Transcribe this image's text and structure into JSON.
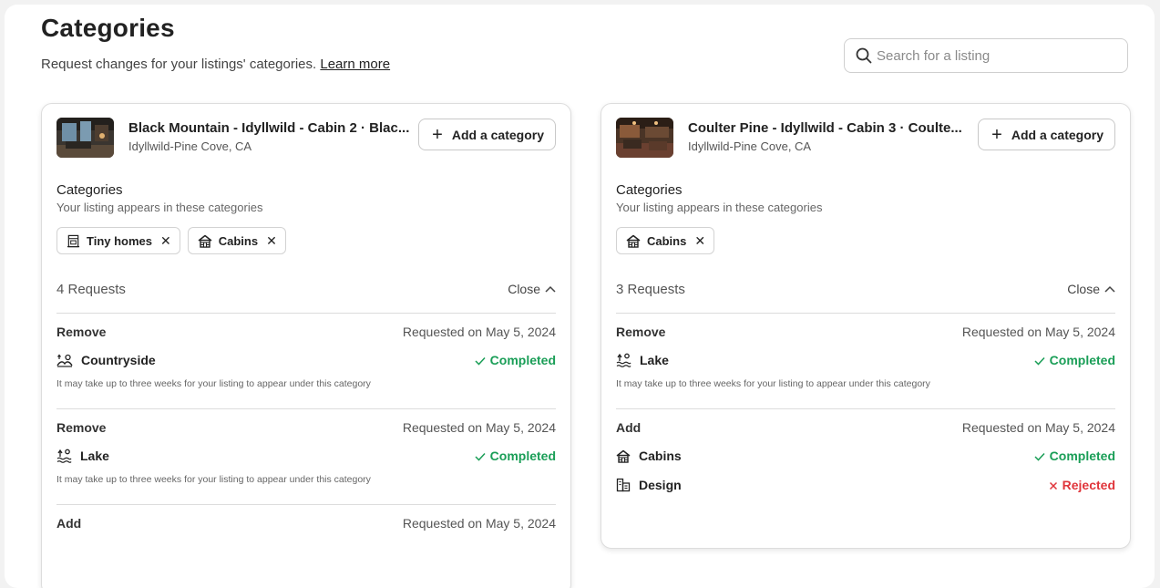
{
  "header": {
    "title": "Categories",
    "subtitle": "Request changes for your listings' categories.",
    "learn_more": "Learn more"
  },
  "search": {
    "placeholder": "Search for a listing"
  },
  "colors": {
    "completed": "#1a9e57",
    "rejected": "#e0353b",
    "border": "#dddddd"
  },
  "listings": [
    {
      "name": "Black Mountain - Idyllwild - Cabin 2 · Blac...",
      "location": "Idyllwild-Pine Cove, CA",
      "add_label": "Add a category",
      "categories_title": "Categories",
      "categories_subtitle": "Your listing appears in these categories",
      "chips": [
        {
          "label": "Tiny homes",
          "icon": "tiny-home-icon"
        },
        {
          "label": "Cabins",
          "icon": "cabin-icon"
        }
      ],
      "requests_label": "4 Requests",
      "close_label": "Close",
      "requests": [
        {
          "action": "Remove",
          "date": "Requested on May 5, 2024",
          "items": [
            {
              "label": "Countryside",
              "icon": "countryside-icon",
              "status": "Completed"
            }
          ],
          "note": "It may take up to three weeks for your listing to appear under this category"
        },
        {
          "action": "Remove",
          "date": "Requested on May 5, 2024",
          "items": [
            {
              "label": "Lake",
              "icon": "lake-icon",
              "status": "Completed"
            }
          ],
          "note": "It may take up to three weeks for your listing to appear under this category"
        },
        {
          "action": "Add",
          "date": "Requested on May 5, 2024",
          "items": []
        }
      ]
    },
    {
      "name": "Coulter Pine - Idyllwild - Cabin 3 · Coulte...",
      "location": "Idyllwild-Pine Cove, CA",
      "add_label": "Add a category",
      "categories_title": "Categories",
      "categories_subtitle": "Your listing appears in these categories",
      "chips": [
        {
          "label": "Cabins",
          "icon": "cabin-icon"
        }
      ],
      "requests_label": "3 Requests",
      "close_label": "Close",
      "requests": [
        {
          "action": "Remove",
          "date": "Requested on May 5, 2024",
          "items": [
            {
              "label": "Lake",
              "icon": "lake-icon",
              "status": "Completed"
            }
          ],
          "note": "It may take up to three weeks for your listing to appear under this category"
        },
        {
          "action": "Add",
          "date": "Requested on May 5, 2024",
          "items": [
            {
              "label": "Cabins",
              "icon": "cabin-icon",
              "status": "Completed"
            },
            {
              "label": "Design",
              "icon": "design-icon",
              "status": "Rejected"
            }
          ]
        }
      ]
    }
  ]
}
